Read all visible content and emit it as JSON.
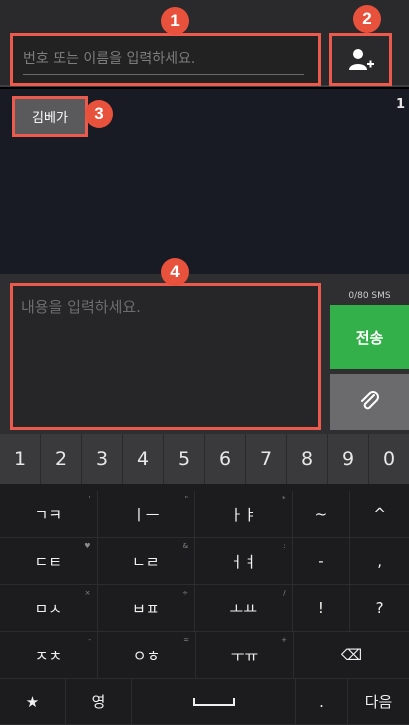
{
  "recipient": {
    "placeholder": "번호 또는 이름을 입력하세요."
  },
  "recipient_chip": "김베가",
  "thread": {
    "count": "1"
  },
  "compose": {
    "placeholder": "내용을 입력하세요.",
    "counter": "0/80 SMS",
    "send_label": "전송"
  },
  "badges": [
    "1",
    "2",
    "3",
    "4"
  ],
  "keyboard": {
    "numbers": [
      "1",
      "2",
      "3",
      "4",
      "5",
      "6",
      "7",
      "8",
      "9",
      "0"
    ],
    "rows": [
      {
        "keys": [
          {
            "label": "ㄱㅋ",
            "sub": "'"
          },
          {
            "label": "ㅣㅡ",
            "sub": "\""
          },
          {
            "label": "ㅏㅑ",
            "sub": "*"
          },
          {
            "label": "~",
            "sub": ""
          },
          {
            "label": "^",
            "sub": ""
          }
        ]
      },
      {
        "keys": [
          {
            "label": "ㄷㅌ",
            "sub": "♥"
          },
          {
            "label": "ㄴㄹ",
            "sub": "&"
          },
          {
            "label": "ㅓㅕ",
            "sub": ":"
          },
          {
            "label": "-",
            "sub": ""
          },
          {
            "label": ",",
            "sub": ""
          }
        ]
      },
      {
        "keys": [
          {
            "label": "ㅁㅅ",
            "sub": "×"
          },
          {
            "label": "ㅂㅍ",
            "sub": "÷"
          },
          {
            "label": "ㅗㅛ",
            "sub": "/"
          },
          {
            "label": "!",
            "sub": ""
          },
          {
            "label": "?",
            "sub": ""
          }
        ]
      },
      {
        "keys": [
          {
            "label": "ㅈㅊ",
            "sub": "-"
          },
          {
            "label": "ㅇㅎ",
            "sub": "="
          },
          {
            "label": "ㅜㅠ",
            "sub": "+"
          },
          {
            "label": "⌫",
            "sub": ""
          }
        ]
      }
    ],
    "bottom": {
      "star": "★",
      "lang": "영",
      "period": ".",
      "next": "다음"
    }
  },
  "colors": {
    "highlight": "#ec5a4e",
    "badge": "#e8513c",
    "send": "#34b04a"
  }
}
